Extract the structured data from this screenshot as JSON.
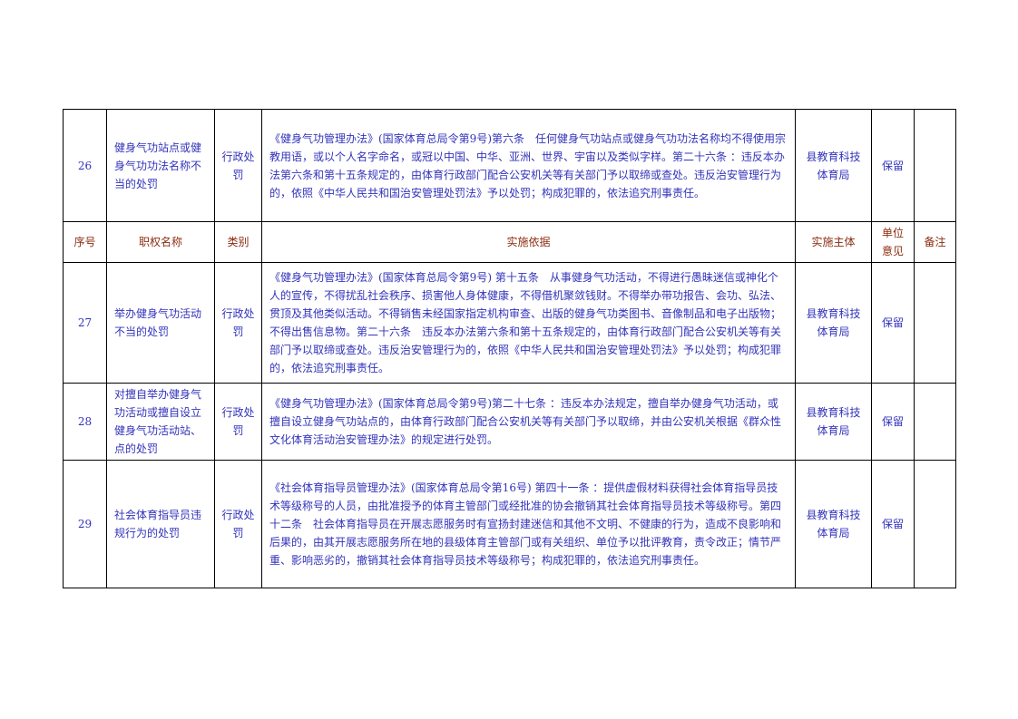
{
  "header": {
    "seq": "序号",
    "name": "职权名称",
    "category": "类别",
    "basis": "实施依据",
    "subject": "实施主体",
    "unit_opinion": "单位意见",
    "remark": "备注"
  },
  "rows": [
    {
      "seq": "26",
      "name": "健身气功站点或健身气功功法名称不当的处罚",
      "category": "行政处罚",
      "basis": "《健身气功管理办法》(国家体育总局令第9号)第六条　任何健身气功站点或健身气功功法名称均不得使用宗教用语，或以个人名字命名，或冠以中国、中华、亚洲、世界、宇宙以及类似字样。第二十六条 ：违反本办法第六条和第十五条规定的，由体育行政部门配合公安机关等有关部门予以取缔或查处。违反治安管理行为的，依照《中华人民共和国治安管理处罚法》予以处罚；构成犯罪的，依法追究刑事责任。",
      "subject": "县教育科技体育局",
      "opinion": "保留",
      "remark": ""
    },
    {
      "seq": "27",
      "name": "举办健身气功活动不当的处罚",
      "category": "行政处罚",
      "basis": "《健身气功管理办法》(国家体育总局令第9号) 第十五条　从事健身气功活动，不得进行愚昧迷信或神化个人的宣传，不得扰乱社会秩序、损害他人身体健康，不得借机聚敛钱财。不得举办带功报告、会功、弘法、贯顶及其他类似活动。不得销售未经国家指定机构审查、出版的健身气功类图书、音像制品和电子出版物；不得出售信息物。第二十六条　违反本办法第六条和第十五条规定的，由体育行政部门配合公安机关等有关部门予以取缔或查处。违反治安管理行为的，依照《中华人民共和国治安管理处罚法》予以处罚；构成犯罪的，依法追究刑事责任。",
      "subject": "县教育科技体育局",
      "opinion": "保留",
      "remark": ""
    },
    {
      "seq": "28",
      "name": "对擅自举办健身气功活动或擅自设立健身气功活动站、点的处罚",
      "category": "行政处罚",
      "basis": "《健身气功管理办法》(国家体育总局令第9号)第二十七条 ：违反本办法规定，擅自举办健身气功活动，或擅自设立健身气功站点的，由体育行政部门配合公安机关等有关部门予以取缔，并由公安机关根据《群众性文化体育活动治安管理办法》的规定进行处罚。",
      "subject": "县教育科技体育局",
      "opinion": "保留",
      "remark": ""
    },
    {
      "seq": "29",
      "name": "社会体育指导员违规行为的处罚",
      "category": "行政处罚",
      "basis": "《社会体育指导员管理办法》(国家体育总局令第16号) 第四十一条 ：提供虚假材料获得社会体育指导员技术等级称号的人员，由批准授予的体育主管部门或经批准的协会撤销其社会体育指导员技术等级称号。第四十二条　社会体育指导员在开展志愿服务时有宣扬封建迷信和其他不文明、不健康的行为，造成不良影响和后果的，由其开展志愿服务所在地的县级体育主管部门或有关组织、单位予以批评教育，责令改正；情节严重、影响恶劣的，撤销其社会体育指导员技术等级称号；构成犯罪的，依法追究刑事责任。",
      "subject": "县教育科技体育局",
      "opinion": "保留",
      "remark": ""
    }
  ]
}
